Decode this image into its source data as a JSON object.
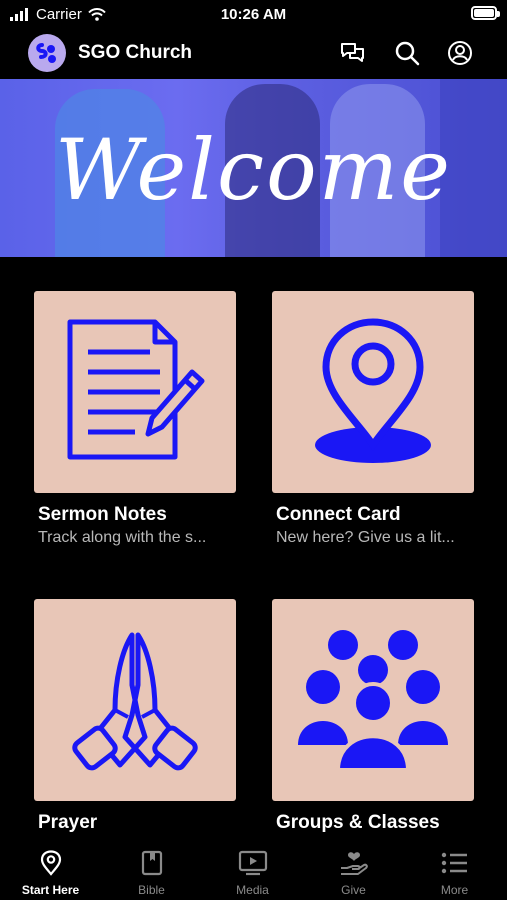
{
  "status_bar": {
    "carrier": "Carrier",
    "time": "10:26 AM",
    "battery_level": 1.0
  },
  "header": {
    "app_title": "SGO Church",
    "icons": [
      "chat-icon",
      "search-icon",
      "account-icon"
    ]
  },
  "hero": {
    "text": "Welcome"
  },
  "tiles": [
    {
      "title": "Sermon Notes",
      "subtitle": "Track along with the s...",
      "icon": "notes-icon"
    },
    {
      "title": "Connect Card",
      "subtitle": "New here? Give us a lit...",
      "icon": "location-pin-icon"
    },
    {
      "title": "Prayer",
      "subtitle": "",
      "icon": "praying-hands-icon"
    },
    {
      "title": "Groups & Classes",
      "subtitle": "",
      "icon": "group-icon"
    }
  ],
  "tabbar": {
    "tabs": [
      {
        "label": "Start Here",
        "icon": "location-pin-icon",
        "active": true
      },
      {
        "label": "Bible",
        "icon": "book-icon",
        "active": false
      },
      {
        "label": "Media",
        "icon": "play-screen-icon",
        "active": false
      },
      {
        "label": "Give",
        "icon": "give-hand-icon",
        "active": false
      },
      {
        "label": "More",
        "icon": "list-icon",
        "active": false
      }
    ]
  },
  "colors": {
    "accent": "#1a17f5",
    "tile_bg": "#e8c6b7",
    "hero_overlay": "#5b5ee6",
    "background": "#000000"
  }
}
